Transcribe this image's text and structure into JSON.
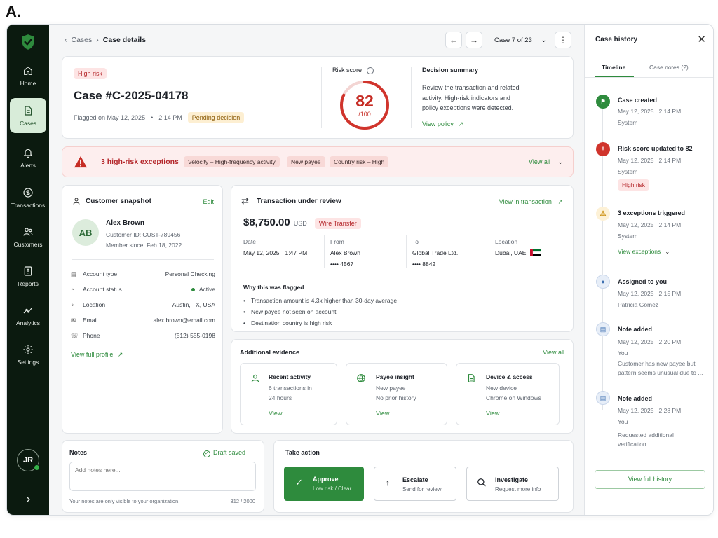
{
  "page_label": "A.",
  "sidebar": {
    "items": [
      {
        "label": "Home",
        "icon": "home-icon",
        "active": false
      },
      {
        "label": "Cases",
        "icon": "document-icon",
        "active": true
      },
      {
        "label": "Alerts",
        "icon": "bell-icon",
        "active": false
      },
      {
        "label": "Transactions",
        "icon": "dollar-icon",
        "active": false
      },
      {
        "label": "Customers",
        "icon": "users-icon",
        "active": false
      },
      {
        "label": "Reports",
        "icon": "report-icon",
        "active": false
      },
      {
        "label": "Analytics",
        "icon": "analytics-icon",
        "active": false
      },
      {
        "label": "Settings",
        "icon": "gear-icon",
        "active": false
      }
    ],
    "user_initials": "JR"
  },
  "breadcrumb": {
    "parent": "Cases",
    "current": "Case details"
  },
  "pager": {
    "label": "Case 7 of 23"
  },
  "case": {
    "risk_badge": "High risk",
    "title": "Case #C-2025-04178",
    "flagged": "Flagged on May 12, 2025",
    "time": "2:14 PM",
    "status": "Pending decision"
  },
  "risk": {
    "label": "Risk score",
    "score": "82",
    "max": "/100",
    "value": 0.82
  },
  "decision": {
    "title": "Decision summary",
    "lines": [
      "Review the transaction and related",
      "activity. High-risk indicators and",
      "policy exceptions were detected."
    ],
    "link": "View policy"
  },
  "exceptions": {
    "title": "3 high-risk exceptions",
    "tags": [
      "Velocity – High-frequency activity",
      "New payee",
      "Country risk – High"
    ],
    "view_all": "View all"
  },
  "customer": {
    "title": "Customer snapshot",
    "edit": "Edit",
    "initials": "AB",
    "name": "Alex Brown",
    "id": "Customer ID: CUST-789456",
    "since": "Member since: Feb 18, 2022",
    "rows": [
      {
        "icon": "account-icon",
        "label": "Account type",
        "value": "Personal Checking"
      },
      {
        "icon": "status-icon",
        "label": "Account status",
        "value": "Active"
      },
      {
        "icon": "location-icon",
        "label": "Location",
        "value": "Austin, TX, USA"
      },
      {
        "icon": "mail-icon",
        "label": "Email",
        "value": "alex.brown@email.com"
      },
      {
        "icon": "phone-icon",
        "label": "Phone",
        "value": "(512) 555-0198"
      }
    ],
    "profile_link": "View full profile"
  },
  "transaction": {
    "title": "Transaction under review",
    "view_link": "View in transaction",
    "amount": "$8,750.00",
    "currency": "USD",
    "type": "Wire Transfer",
    "date_label": "Date",
    "date": "May 12, 2025",
    "time": "1:47 PM",
    "from_label": "From",
    "from_name": "Alex Brown",
    "from_acct": "•••• 4567",
    "to_label": "To",
    "to_name": "Global Trade Ltd.",
    "to_acct": "•••• 8842",
    "loc_label": "Location",
    "loc": "Dubai, UAE",
    "why_title": "Why this was flagged",
    "reasons": [
      "Transaction amount is 4.3x higher than 30-day average",
      "New payee not seen on account",
      "Destination country is high risk"
    ]
  },
  "evidence": {
    "title": "Additional evidence",
    "view_all": "View all",
    "items": [
      {
        "icon": "person-icon",
        "title": "Recent activity",
        "l1": "6 transactions in",
        "l2": "24 hours",
        "link": "View"
      },
      {
        "icon": "globe-icon",
        "title": "Payee insight",
        "l1": "New payee",
        "l2": "No prior history",
        "link": "View"
      },
      {
        "icon": "file-icon",
        "title": "Device & access",
        "l1": "New device",
        "l2": "Chrome on Windows",
        "link": "View"
      }
    ]
  },
  "notes": {
    "title": "Notes",
    "saved": "Draft saved",
    "placeholder": "Add notes here...",
    "hint": "Your notes are only visible to your organization.",
    "count": "312 / 2000"
  },
  "actions": {
    "title": "Take action",
    "approve": {
      "label": "Approve",
      "sub": "Low risk / Clear"
    },
    "escalate": {
      "label": "Escalate",
      "sub": "Send for review"
    },
    "investigate": {
      "label": "Investigate",
      "sub": "Request more info"
    }
  },
  "history": {
    "title": "Case history",
    "tabs": [
      "Timeline",
      "Case notes (2)"
    ],
    "events": [
      {
        "title": "Case created",
        "date": "May 12, 2025",
        "time": "2:14 PM",
        "by": "System"
      },
      {
        "title": "Risk score updated to 82",
        "date": "May 12, 2025",
        "time": "2:14 PM",
        "by": "System",
        "badge": "High risk"
      },
      {
        "title": "3 exceptions triggered",
        "date": "May 12, 2025",
        "time": "2:14 PM",
        "by": "System",
        "link": "View exceptions"
      },
      {
        "title": "Assigned to you",
        "date": "May 12, 2025",
        "time": "2:15 PM",
        "by": "Patricia Gomez"
      },
      {
        "title": "Note added",
        "date": "May 12, 2025",
        "time": "2:20 PM",
        "by": "You",
        "note1": "Customer has new payee but",
        "note2": "pattern seems unusual due to ..."
      },
      {
        "title": "Note added",
        "date": "May 12, 2025",
        "time": "2:28 PM",
        "by": "You",
        "note1": "Requested additional",
        "note2": "verification."
      }
    ],
    "full_button": "View full history"
  },
  "colors": {
    "brand": "#2e8b3d",
    "danger": "#d0342c",
    "sidebar": "#0b1a0f"
  }
}
